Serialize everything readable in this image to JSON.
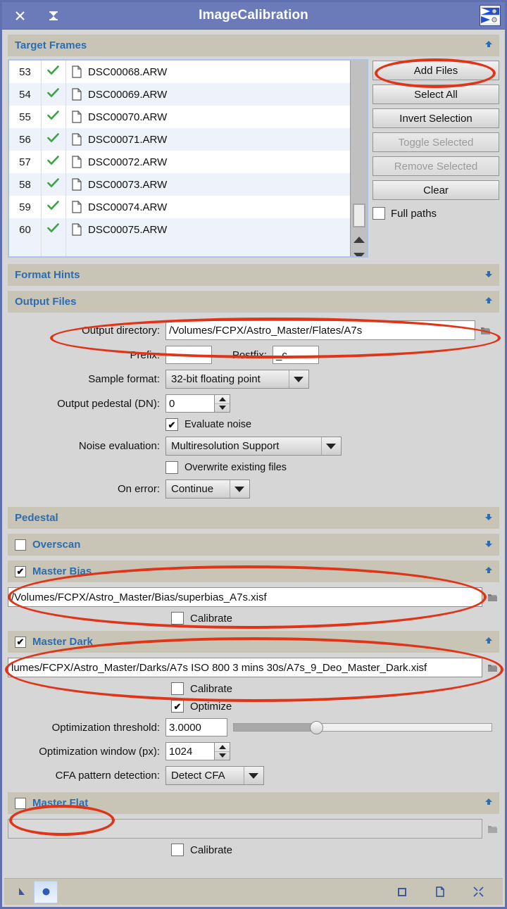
{
  "window": {
    "title": "ImageCalibration",
    "close_icon": "close-icon",
    "collapse_icon": "collapse-icon",
    "process_icon": "imagecalibration-process-icon"
  },
  "sections": {
    "target_frames": {
      "title": "Target Frames",
      "state": "expanded",
      "arrow": "▲"
    },
    "format_hints": {
      "title": "Format Hints",
      "state": "collapsed",
      "arrow": "▼"
    },
    "output_files": {
      "title": "Output Files",
      "state": "expanded",
      "arrow": "▲"
    },
    "pedestal": {
      "title": "Pedestal",
      "state": "collapsed",
      "arrow": "▼"
    },
    "overscan": {
      "title": "Overscan",
      "state": "collapsed",
      "arrow": "▼",
      "checked": false,
      "check": ""
    },
    "master_bias": {
      "title": "Master Bias",
      "state": "expanded",
      "arrow": "▲",
      "checked": true,
      "check": "✔"
    },
    "master_dark": {
      "title": "Master Dark",
      "state": "expanded",
      "arrow": "▲",
      "checked": true,
      "check": "✔"
    },
    "master_flat": {
      "title": "Master Flat",
      "state": "expanded",
      "arrow": "▲",
      "checked": false,
      "check": ""
    }
  },
  "target_frames": {
    "columns": [
      "index",
      "enabled",
      "icon",
      "filename"
    ],
    "rows": [
      {
        "index": "53",
        "enabled": "✔",
        "filename": "DSC00068.ARW"
      },
      {
        "index": "54",
        "enabled": "✔",
        "filename": "DSC00069.ARW"
      },
      {
        "index": "55",
        "enabled": "✔",
        "filename": "DSC00070.ARW"
      },
      {
        "index": "56",
        "enabled": "✔",
        "filename": "DSC00071.ARW"
      },
      {
        "index": "57",
        "enabled": "✔",
        "filename": "DSC00072.ARW"
      },
      {
        "index": "58",
        "enabled": "✔",
        "filename": "DSC00073.ARW"
      },
      {
        "index": "59",
        "enabled": "✔",
        "filename": "DSC00074.ARW"
      },
      {
        "index": "60",
        "enabled": "✔",
        "filename": "DSC00075.ARW"
      }
    ],
    "buttons": [
      {
        "label": "Add Files",
        "enabled": true
      },
      {
        "label": "Select All",
        "enabled": true
      },
      {
        "label": "Invert Selection",
        "enabled": true
      },
      {
        "label": "Toggle Selected",
        "enabled": false
      },
      {
        "label": "Remove Selected",
        "enabled": false
      },
      {
        "label": "Clear",
        "enabled": true
      }
    ],
    "full_paths": {
      "label": "Full paths",
      "checked": false,
      "check": ""
    }
  },
  "output_files": {
    "output_directory": {
      "label": "Output directory:",
      "value": "/Volumes/FCPX/Astro_Master/Flates/A7s"
    },
    "prefix": {
      "label": "Prefix:",
      "value": ""
    },
    "postfix": {
      "label": "Postfix:",
      "value": "_c"
    },
    "sample_format": {
      "label": "Sample format:",
      "value": "32-bit floating point"
    },
    "output_pedestal": {
      "label": "Output pedestal (DN):",
      "value": "0"
    },
    "evaluate_noise": {
      "label": "Evaluate noise",
      "checked": true,
      "check": "✔"
    },
    "noise_evaluation": {
      "label": "Noise evaluation:",
      "value": "Multiresolution Support"
    },
    "overwrite_existing": {
      "label": "Overwrite existing files",
      "checked": false,
      "check": ""
    },
    "on_error": {
      "label": "On error:",
      "value": "Continue"
    }
  },
  "master_bias": {
    "path": "/Volumes/FCPX/Astro_Master/Bias/superbias_A7s.xisf",
    "calibrate": {
      "label": "Calibrate",
      "checked": false,
      "check": ""
    }
  },
  "master_dark": {
    "path": "lumes/FCPX/Astro_Master/Darks/A7s ISO 800 3 mins 30s/A7s_9_Deo_Master_Dark.xisf",
    "calibrate": {
      "label": "Calibrate",
      "checked": false,
      "check": ""
    },
    "optimize": {
      "label": "Optimize",
      "checked": true,
      "check": "✔"
    },
    "optimization_threshold": {
      "label": "Optimization threshold:",
      "value": "3.0000",
      "slider_percent": 32
    },
    "optimization_window": {
      "label": "Optimization window (px):",
      "value": "1024"
    },
    "cfa_pattern_detection": {
      "label": "CFA pattern detection:",
      "value": "Detect CFA"
    }
  },
  "master_flat": {
    "path": "",
    "calibrate": {
      "label": "Calibrate",
      "checked": false,
      "check": ""
    }
  },
  "bottom_bar": {
    "icons": [
      "arrow-cursor-icon",
      "apply-global-icon",
      "square-icon",
      "new-instance-icon",
      "reset-icon"
    ]
  },
  "colors": {
    "titlebar": "#6b7ab8",
    "section_header": "#c9c5b6",
    "section_title_text": "#2c6cb0",
    "panel_bg": "#d6d6d6",
    "annotation": "#e03418",
    "check_green": "#3ba246"
  }
}
